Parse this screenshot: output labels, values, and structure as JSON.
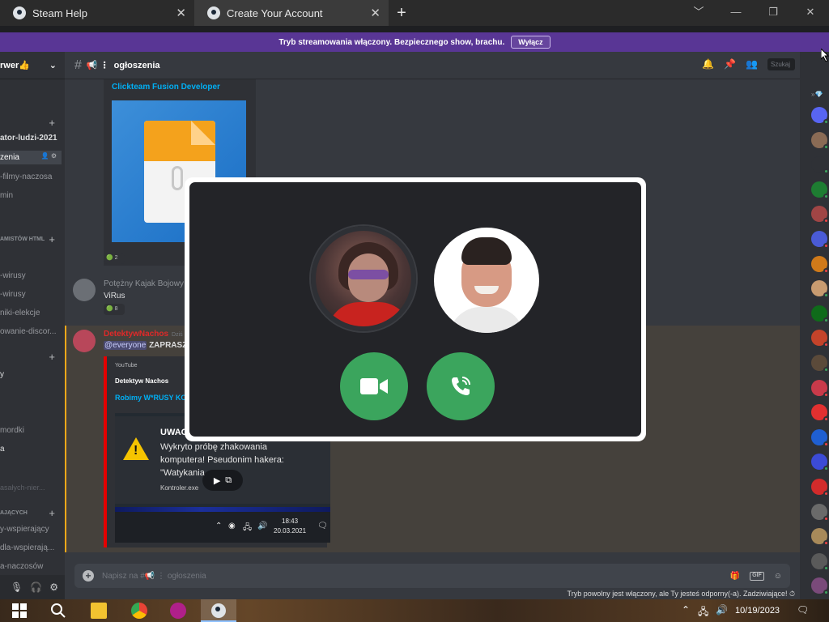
{
  "browser": {
    "tabs": [
      {
        "title": "Steam Help",
        "close": "✕"
      },
      {
        "title": "Create Your Account",
        "close": "✕"
      }
    ],
    "new_tab": "+",
    "window_controls": [
      "﹀",
      "—",
      "❐",
      "✕"
    ]
  },
  "banner": {
    "text": "Tryb streamowania włączony. Bezpiecznego show, brachu.",
    "button": "Wyłącz"
  },
  "sidebar": {
    "server_name": "rwer👍",
    "channels": [
      {
        "label": "ator-ludzi-2021",
        "style": "white"
      },
      {
        "label": "zenia",
        "style": "sel"
      },
      {
        "label": "-filmy-naczosa",
        "style": ""
      },
      {
        "label": "min",
        "style": ""
      },
      {
        "label": "AMISTÓW HTML",
        "style": "cat"
      },
      {
        "label": "-wirusy",
        "style": ""
      },
      {
        "label": "-wirusy",
        "style": ""
      },
      {
        "label": "niki-elekcje",
        "style": ""
      },
      {
        "label": "owanie-discor...",
        "style": ""
      },
      {
        "label": "y",
        "style": "white"
      },
      {
        "label": "mordki",
        "style": ""
      },
      {
        "label": "a",
        "style": "white"
      },
      {
        "label": "asałych-nier...",
        "style": "faint"
      },
      {
        "label": "AJĄCYCH",
        "style": "cat"
      },
      {
        "label": "y-wspierający",
        "style": ""
      },
      {
        "label": "dla-wspierają...",
        "style": ""
      },
      {
        "label": "a-naczosów",
        "style": ""
      }
    ]
  },
  "chat": {
    "channel_name": "ogłoszenia",
    "channel_prefix": "📢 ⋮",
    "search_placeholder": "Szukaj",
    "embed1": {
      "title": "Clickteam Fusion Developer",
      "reaction": "2"
    },
    "msg1": {
      "author": "Potężny Kajak Bojowy",
      "text": "ViRus",
      "reaction": "8"
    },
    "msg2": {
      "author": "DetektywNachos",
      "timestamp": "Dziś o",
      "mention": "@everyone",
      "text": "ZAPRASZA",
      "embed": {
        "provider": "YouTube",
        "author": "Detektyw Nachos",
        "title": "Robimy W*RUSY KO",
        "video": {
          "heading": "UWAGA!",
          "line1": "Wykryto próbę zhakowania",
          "line2": "komputera! Pseudonim hakera:",
          "line3": "\"Watykania",
          "file": "Kontroler.exe",
          "time": "18:43",
          "date": "20.03.2021"
        }
      }
    },
    "composer_placeholder": "Napisz na #📢 ⋮ ogłoszenia",
    "gif_label": "GIF",
    "slowmode": "Tryb powolny jest włączony, ale Ty jesteś odporny(-a). Zadziwiające! ⏱"
  },
  "colors": {
    "banner": "#593695",
    "call_green": "#3ba55d",
    "link": "#00aff4",
    "mention_border": "#faa81a"
  },
  "members": [
    {
      "color": "#5865f2",
      "status": "#3ba55d"
    },
    {
      "color": "#8a6b55",
      "status": "#3ba55d"
    },
    {
      "color": "#2f3136",
      "status": "#3ba55d"
    },
    {
      "color": "#1e7d32",
      "status": "#3ba55d"
    },
    {
      "color": "#a04545",
      "status": "#ed4245"
    },
    {
      "color": "#4a5bd6",
      "status": "#ed4245"
    },
    {
      "color": "#d07a1a",
      "status": "#ed4245"
    },
    {
      "color": "#c89b70",
      "status": "#3ba55d"
    },
    {
      "color": "#0f6b1a",
      "status": "#3ba55d"
    },
    {
      "color": "#c4432a",
      "status": "#ed4245"
    },
    {
      "color": "#5b4a3a",
      "status": "#3ba55d"
    },
    {
      "color": "#c93a4a",
      "status": "#ed4245"
    },
    {
      "color": "#e23030",
      "status": "#ed4245"
    },
    {
      "color": "#1f5fd1",
      "status": "#ed4245"
    },
    {
      "color": "#3c4bd6",
      "status": "#3ba55d"
    },
    {
      "color": "#d22b2b",
      "status": "#ed4245"
    },
    {
      "color": "#6a6a6a",
      "status": "#ed4245"
    },
    {
      "color": "#a88a5a",
      "status": "#ed4245"
    },
    {
      "color": "#5a5a5a",
      "status": "#3ba55d"
    },
    {
      "color": "#7a4a7a",
      "status": "#3ba55d"
    }
  ],
  "taskbar": {
    "date": "10/19/2023"
  }
}
